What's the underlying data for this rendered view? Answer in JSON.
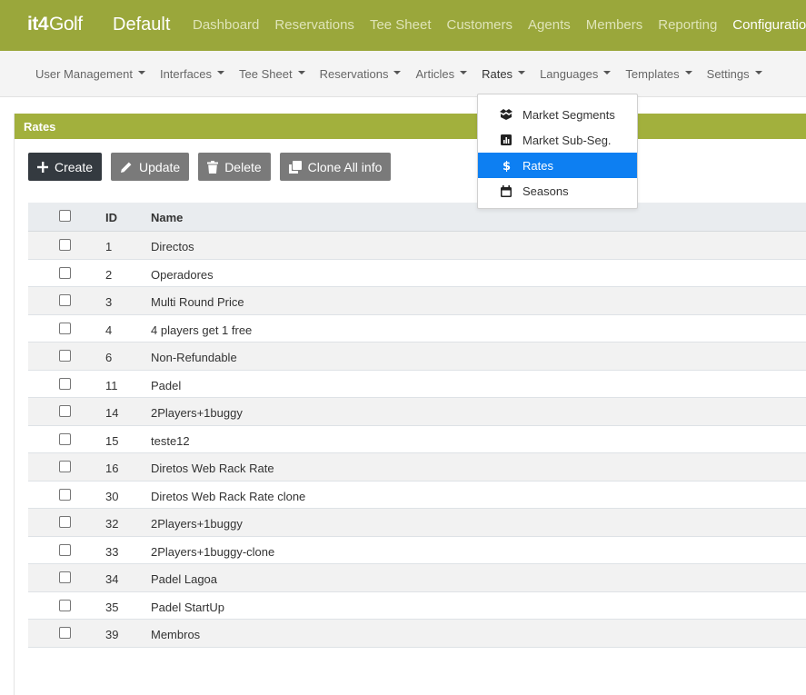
{
  "brand": {
    "logo_it4": "it4",
    "logo_golf": "Golf",
    "name": "Default"
  },
  "topnav": [
    {
      "label": "Dashboard",
      "active": false
    },
    {
      "label": "Reservations",
      "active": false
    },
    {
      "label": "Tee Sheet",
      "active": false
    },
    {
      "label": "Customers",
      "active": false
    },
    {
      "label": "Agents",
      "active": false
    },
    {
      "label": "Members",
      "active": false
    },
    {
      "label": "Reporting",
      "active": false
    },
    {
      "label": "Configuration",
      "active": true
    }
  ],
  "subnav": [
    "User Management",
    "Interfaces",
    "Tee Sheet",
    "Reservations",
    "Articles",
    "Rates",
    "Languages",
    "Templates",
    "Settings"
  ],
  "dropdown": [
    {
      "label": "Market Segments",
      "icon": "boxes-icon"
    },
    {
      "label": "Market Sub-Seg.",
      "icon": "chart-icon"
    },
    {
      "label": "Rates",
      "icon": "dollar-icon",
      "active": true
    },
    {
      "label": "Seasons",
      "icon": "calendar-icon"
    }
  ],
  "card": {
    "title": "Rates"
  },
  "toolbar": {
    "create": "Create",
    "update": "Update",
    "delete": "Delete",
    "clone": "Clone All info"
  },
  "table": {
    "headers": {
      "id": "ID",
      "name": "Name"
    },
    "rows": [
      {
        "id": "1",
        "name": "Directos"
      },
      {
        "id": "2",
        "name": "Operadores"
      },
      {
        "id": "3",
        "name": "Multi Round Price"
      },
      {
        "id": "4",
        "name": "4 players get 1 free"
      },
      {
        "id": "6",
        "name": "Non-Refundable"
      },
      {
        "id": "11",
        "name": "Padel"
      },
      {
        "id": "14",
        "name": "2Players+1buggy"
      },
      {
        "id": "15",
        "name": "teste12"
      },
      {
        "id": "16",
        "name": "Diretos Web Rack Rate"
      },
      {
        "id": "30",
        "name": "Diretos Web Rack Rate clone"
      },
      {
        "id": "32",
        "name": "2Players+1buggy"
      },
      {
        "id": "33",
        "name": "2Players+1buggy-clone"
      },
      {
        "id": "34",
        "name": "Padel Lagoa"
      },
      {
        "id": "35",
        "name": "Padel StartUp"
      },
      {
        "id": "39",
        "name": "Membros"
      }
    ]
  },
  "colors": {
    "topbar": "#9aa73b",
    "card_header": "#a2b03d",
    "dropdown_active": "#0d7ff2",
    "create_button": "#343a40",
    "secondary_button": "#7a7a7a"
  }
}
